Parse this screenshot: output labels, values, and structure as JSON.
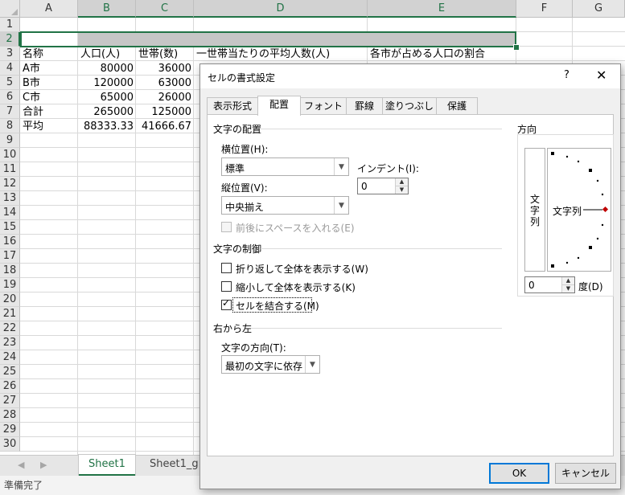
{
  "spreadsheet": {
    "columns": [
      "A",
      "B",
      "C",
      "D",
      "E",
      "F",
      "G"
    ],
    "rows": [
      "1",
      "2",
      "3",
      "4",
      "5",
      "6",
      "7",
      "8",
      "9",
      "10",
      "11",
      "12",
      "13",
      "14",
      "15",
      "16",
      "17",
      "18",
      "19",
      "20",
      "21",
      "22",
      "23",
      "24",
      "25",
      "26",
      "27",
      "28",
      "29",
      "30"
    ],
    "header_row": {
      "a": "名称",
      "b": "人口(人)",
      "c": "世帯(数)",
      "d": "一世帯当たりの平均人数(人)",
      "e": "各市が占める人口の割合"
    },
    "data_rows": [
      {
        "a": "A市",
        "b": "80000",
        "c": "36000"
      },
      {
        "a": "B市",
        "b": "120000",
        "c": "63000"
      },
      {
        "a": "C市",
        "b": "65000",
        "c": "26000"
      },
      {
        "a": "合計",
        "b": "265000",
        "c": "125000"
      },
      {
        "a": "平均",
        "b": "88333.33",
        "c": "41666.67"
      }
    ],
    "sheet_tabs": [
      "Sheet1",
      "Sheet1_g"
    ],
    "status": "準備完了",
    "accent_color": "#217346"
  },
  "dialog": {
    "title": "セルの書式設定",
    "help": "?",
    "close": "✕",
    "tabs": [
      "表示形式",
      "配置",
      "フォント",
      "罫線",
      "塗りつぶし",
      "保護"
    ],
    "active_tab": "配置",
    "text_alignment": {
      "group": "文字の配置",
      "horizontal_label": "横位置(H):",
      "horizontal_value": "標準",
      "vertical_label": "縦位置(V):",
      "vertical_value": "中央揃え",
      "indent_label": "インデント(I):",
      "indent_value": "0",
      "distributed_label": "前後にスペースを入れる(E)",
      "distributed_checked": false
    },
    "text_control": {
      "group": "文字の制御",
      "wrap_label": "折り返して全体を表示する(W)",
      "wrap_checked": false,
      "shrink_label": "縮小して全体を表示する(K)",
      "shrink_checked": false,
      "merge_label": "セルを結合する(M)",
      "merge_checked": true
    },
    "rtl": {
      "group": "右から左",
      "direction_label": "文字の方向(T):",
      "direction_value": "最初の文字に依存"
    },
    "orientation": {
      "group": "方向",
      "vertical_text": "文字列",
      "dial_text": "文字列",
      "degrees_value": "0",
      "degrees_label": "度(D)"
    },
    "ok_label": "OK",
    "cancel_label": "キャンセル",
    "focus_color": "#0078d7",
    "dial_marker_color": "#c00000"
  }
}
